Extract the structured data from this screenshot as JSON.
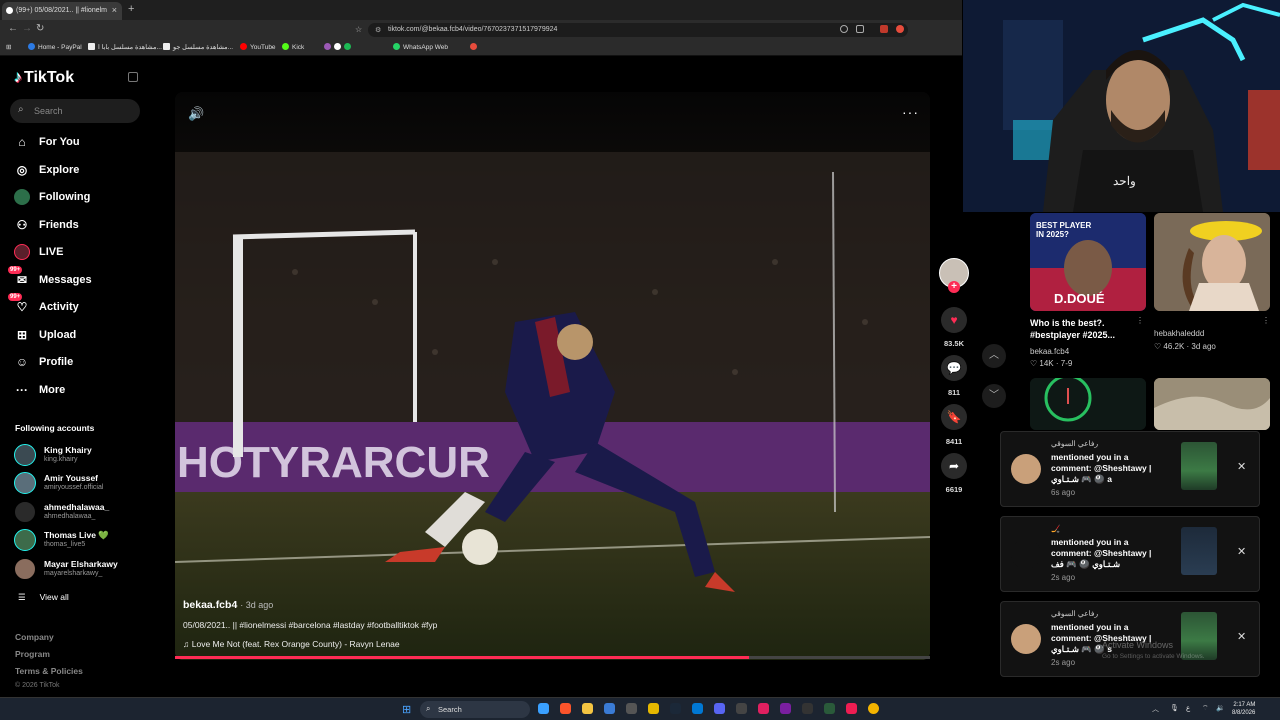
{
  "browser": {
    "tab_title": "(99+) 05/08/2021.. || #lionelm",
    "tab_close": "×",
    "new_tab": "+",
    "url": "tiktok.com/@bekaa.fcb4/video/7670237371517979924",
    "bookmarks": [
      "Home - PayPal",
      "مشاهدة مسلسل بابا ا...",
      "مشاهدة مسلسل جو...",
      "YouTube",
      "Kick",
      "WhatsApp Web"
    ]
  },
  "sidebar": {
    "logo": "TikTok",
    "search_placeholder": "Search",
    "nav": [
      {
        "label": "For You",
        "icon": "home-icon"
      },
      {
        "label": "Explore",
        "icon": "compass-icon"
      },
      {
        "label": "Following",
        "icon": "following-avatar-icon"
      },
      {
        "label": "Friends",
        "icon": "friends-icon"
      },
      {
        "label": "LIVE",
        "icon": "live-icon"
      },
      {
        "label": "Messages",
        "icon": "messages-icon",
        "badge": "99+"
      },
      {
        "label": "Activity",
        "icon": "activity-icon",
        "badge": "99+"
      },
      {
        "label": "Upload",
        "icon": "upload-icon"
      },
      {
        "label": "Profile",
        "icon": "profile-icon"
      },
      {
        "label": "More",
        "icon": "more-dots-icon"
      }
    ],
    "following_title": "Following accounts",
    "accounts": [
      {
        "name": "King Khairy",
        "handle": "king.khairy"
      },
      {
        "name": "Amir Youssef",
        "handle": "amiryoussef.official"
      },
      {
        "name": "ahmedhalawaa_",
        "handle": "ahmedhalawaa_"
      },
      {
        "name": "Thomas Live 💚",
        "handle": "thomas_live5"
      },
      {
        "name": "Mayar Elsharkawy",
        "handle": "mayarelsharkawy_"
      }
    ],
    "view_all": "View all",
    "footer": [
      "Company",
      "Program",
      "Terms & Policies"
    ],
    "copyright": "© 2026 TikTok"
  },
  "video": {
    "username": "bekaa.fcb4",
    "posted": "· 3d ago",
    "caption": "05/08/2021.. || #lionelmessi #barcelona #lastday #footballtiktok #fyp",
    "music": "Love Me Not (feat. Rex Orange County) - Ravyn Lenae",
    "progress": 0.76
  },
  "actions": {
    "likes": "83.5K",
    "comments": "811",
    "saves": "8411",
    "shares": "6619"
  },
  "recommended": [
    {
      "title": "Who is the best?. #bestplayer #2025...",
      "user": "bekaa.fcb4",
      "stats": "♡ 14K · 7-9",
      "thumb_text": "BEST PLAYER IN 2025?",
      "thumb_sub": "D.DOUÉ"
    },
    {
      "title": "",
      "user": "hebakhaleddd",
      "stats": "♡ 46.2K · 3d ago"
    }
  ],
  "notifications": [
    {
      "name": "رفاعي السوقي",
      "message": "mentioned you in a comment: @Sheshtawy | شـتـاوي 🎮 🎱 a",
      "time": "6s ago"
    },
    {
      "name": "🏒",
      "message": "mentioned you in a comment: @Sheshtawy | شـتـاوي 🎱 🎮 فف",
      "time": "2s ago"
    },
    {
      "name": "رفاعي السوقي",
      "message": "mentioned you in a comment: @Sheshtawy | شـتـاوي 🎮 🎱 s",
      "time": "2s ago"
    }
  ],
  "windows_watermark": {
    "line1": "Activate Windows",
    "line2": "Go to Settings to activate Windows."
  },
  "taskbar": {
    "search": "Search",
    "time": "2:17 AM",
    "date": "8/8/2026"
  },
  "colors": {
    "accent": "#fe2c55",
    "cyan": "#25f4ee",
    "bg": "#000000"
  }
}
